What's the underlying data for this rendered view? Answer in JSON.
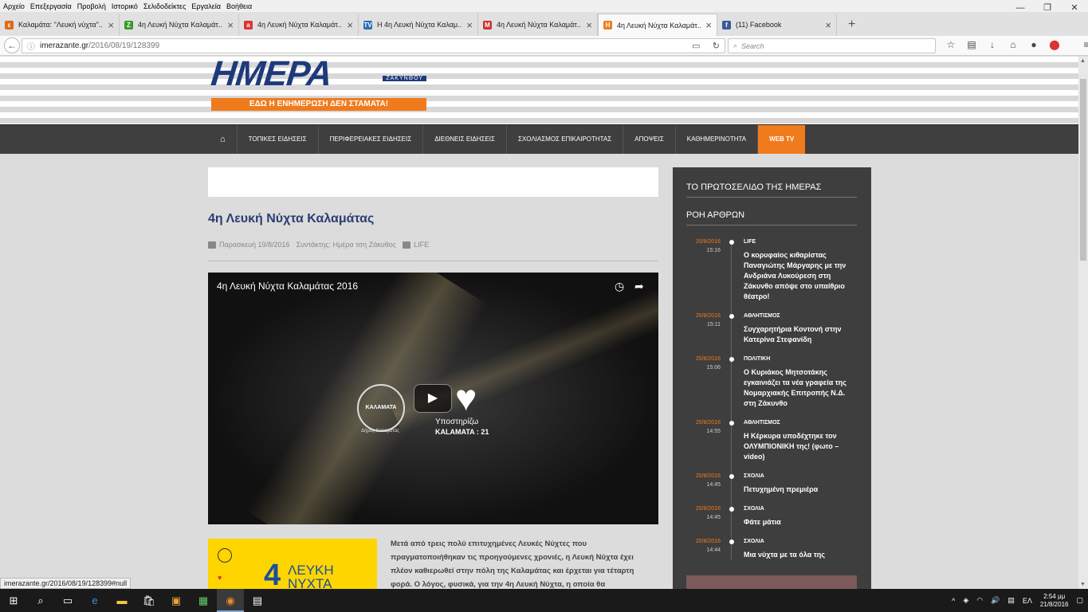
{
  "menubar": [
    "Αρχείο",
    "Επεξεργασία",
    "Προβολή",
    "Ιστορικό",
    "Σελιδοδείκτες",
    "Εργαλεία",
    "Βοήθεια"
  ],
  "tabs": [
    {
      "title": "Καλαμάτα: \"Λευκή νύχτα\"...",
      "fav": "ε",
      "color": "#e06a1a"
    },
    {
      "title": "4η Λευκή Νύχτα Καλαμάτ...",
      "fav": "Z",
      "color": "#3a9a2a"
    },
    {
      "title": "4η Λευκή Νύχτα Καλαμάτ...",
      "fav": "a",
      "color": "#d33"
    },
    {
      "title": "Η 4η Λευκή Νύχτα Καλαμ...",
      "fav": "TV",
      "color": "#2a6fb5"
    },
    {
      "title": "4η Λευκή Νύχτα Καλαμάτ...",
      "fav": "M",
      "color": "#c33"
    },
    {
      "title": "4η Λευκή Νύχτα Καλαμάτ...",
      "fav": "Η",
      "color": "#f07b1d"
    },
    {
      "title": "(11) Facebook",
      "fav": "f",
      "color": "#3b5998"
    }
  ],
  "url": {
    "host": "imerazante.gr",
    "path": "/2016/08/19/128399"
  },
  "search_placeholder": "Search",
  "site": {
    "logo": "ΗΜΕΡΑ",
    "logo_sub": "ΖΑΚΥΝΘΟΥ",
    "slogan": "ΕΔΩ Η ΕΝΗΜΕΡΩΣΗ ΔΕΝ ΣΤΑΜΑΤΑ!"
  },
  "nav": [
    "ΤΟΠΙΚΕΣ ΕΙΔΗΣΕΙΣ",
    "ΠΕΡΙΦΕΡΕΙΑΚΕΣ ΕΙΔΗΣΕΙΣ",
    "ΔΙΕΘΝΕΙΣ ΕΙΔΗΣΕΙΣ",
    "ΣΧΟΛΙΑΣΜΟΣ ΕΠΙΚΑΙΡΟΤΗΤΑΣ",
    "ΑΠΟΨΕΙΣ",
    "ΚΑΘΗΜΕΡΙΝΟΤΗΤΑ",
    "WEB TV"
  ],
  "article": {
    "title": "4η Λευκή Νύχτα Καλαμάτας",
    "date": "Παρασκευή 19/8/2016",
    "author": "Συντάκτης: Ημέρα τση Ζάκυθος",
    "category": "LIFE",
    "video_title": "4η Λευκή Νύχτα Καλαμάτας 2016",
    "video_support": "Υποστηρίζω",
    "video_kalamata": "KALAMATA : 21",
    "seal_text": "ΚΑΛΑΜΑΤΑ",
    "seal_sub": "Δήμος Καλαμάτας",
    "poster_text": "ΛΕΥΚΗ ΝΥΧΤΑ",
    "poster_num": "4",
    "body": "Μετά από τρεις πολύ επιτυχημένες Λευκές Νύχτες που πραγματοποιήθηκαν τις προηγούμενες χρονιές, η Λευκή Νύχτα έχει πλέον καθιερωθεί στην πόλη της Καλαμάτας και έρχεται για τέταρτη φορά. Ο λόγος, φυσικά, για την 4η Λευκή Νύχτα, η οποία θα"
  },
  "sidebar": {
    "heading1": "ΤΟ ΠΡΩΤΟΣΕΛΙΔΟ ΤΗΣ ΗΜΕΡΑΣ",
    "heading2": "ΡΟΗ ΑΡΘΡΩΝ",
    "items": [
      {
        "date": "20/8/2016",
        "time": "15:16",
        "cat": "LIFE",
        "head": "Ο κορυφαίος κιθαρίστας Παναγιώτης Μάργαρης με την Ανδριάνα Λυκούρεση στη Ζάκυνθο απόψε στο υπαίθριο θέατρο!"
      },
      {
        "date": "20/8/2016",
        "time": "15:11",
        "cat": "ΑΘΛΗΤΙΣΜΟΣ",
        "head": "Συγχαρητήρια Κοντονή στην Κατερίνα Στεφανίδη"
      },
      {
        "date": "20/8/2016",
        "time": "15:06",
        "cat": "ΠΟΛΙΤΙΚΗ",
        "head": "Ο Κυριάκος Μητσοτάκης εγκαινιάζει τα νέα γραφεία της Νομαρχιακής Επιτροπής Ν.Δ. στη Ζάκυνθο"
      },
      {
        "date": "20/8/2016",
        "time": "14:55",
        "cat": "ΑΘΛΗΤΙΣΜΟΣ",
        "head": "Η Κέρκυρα υποδέχτηκε τον ΟΛΥΜΠΙΟΝΙΚΗ της! (φωτο – video)"
      },
      {
        "date": "20/8/2016",
        "time": "14:45",
        "cat": "ΣΧΟΛΙΑ",
        "head": "Πετυχημένη πρεμιέρα"
      },
      {
        "date": "20/8/2016",
        "time": "14:45",
        "cat": "ΣΧΟΛΙΑ",
        "head": "Φάτε μάτια"
      },
      {
        "date": "20/8/2016",
        "time": "14:44",
        "cat": "ΣΧΟΛΙΑ",
        "head": "Μια νύχτα με τα όλα της"
      }
    ]
  },
  "status_url": "imerazante.gr/2016/08/19/128399#null",
  "taskbar": {
    "lang": "ΕΛ",
    "time": "2:54 μμ",
    "date": "21/8/2016"
  }
}
